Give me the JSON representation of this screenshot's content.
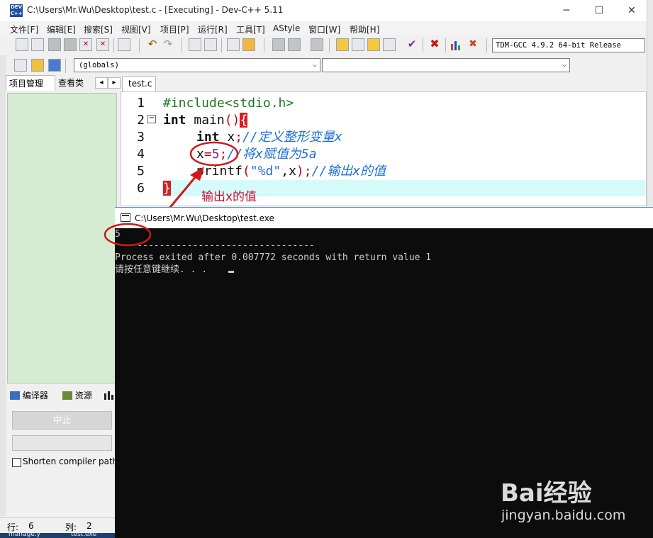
{
  "window": {
    "title": "C:\\Users\\Mr.Wu\\Desktop\\test.c - [Executing] - Dev-C++ 5.11",
    "minimize_glyph": "─",
    "maximize_glyph": "☐",
    "close_glyph": "✕"
  },
  "menu": [
    "文件[F]",
    "编辑[E]",
    "搜索[S]",
    "视图[V]",
    "项目[P]",
    "运行[R]",
    "工具[T]",
    "AStyle",
    "窗口[W]",
    "帮助[H]"
  ],
  "toolbar": {
    "compiler": "TDM-GCC 4.9.2 64-bit Release",
    "scope_combo": "(globals)",
    "function_combo": ""
  },
  "left_panel": {
    "tabs": [
      "项目管理",
      "查看类"
    ],
    "nav_prev": "◂",
    "nav_next": "▸",
    "bottom_tabs": [
      "编译器",
      "资源"
    ],
    "stop_button": "中止",
    "shorten_label": "Shorten compiler paths"
  },
  "status": {
    "row_label": "行:",
    "row_value": "6",
    "col_label": "列:",
    "col_value": "2"
  },
  "editor": {
    "tab": "test.c",
    "line_numbers": [
      "1",
      "2",
      "3",
      "4",
      "5",
      "6"
    ],
    "code": {
      "l1": "#include<stdio.h>",
      "l2_kw": "int",
      "l2_rest": " main",
      "l2_paren": "()",
      "l2_brace": "{",
      "l3_kw": "int",
      "l3_var": " x",
      "l3_semi": ";",
      "l3_cmt": "//定义整形变量x",
      "l4_var": "x",
      "l4_eq": "=",
      "l4_num": "5",
      "l4_semi": ";",
      "l4_cmt": "//将x赋值为5a",
      "l5_fn": "printf",
      "l5_open": "(",
      "l5_str": "\"%d\"",
      "l5_mid": ",x",
      "l5_close": ");",
      "l5_cmt": "//输出x的值",
      "l6_brace": "}"
    }
  },
  "annotation": {
    "text": "输出x的值",
    "color": "#c8102e"
  },
  "console": {
    "title": "C:\\Users\\Mr.Wu\\Desktop\\test.exe",
    "output": "5",
    "separator": "    --------------------------------",
    "exit_msg": "Process exited after 0.007772 seconds with return value 1",
    "prompt": "请按任意键继续. . ."
  },
  "taskbar": {
    "item1": "manage.y",
    "item2": "test.exe"
  },
  "watermark": {
    "logo": "Bai经验",
    "url": "jingyan.baidu.com"
  }
}
